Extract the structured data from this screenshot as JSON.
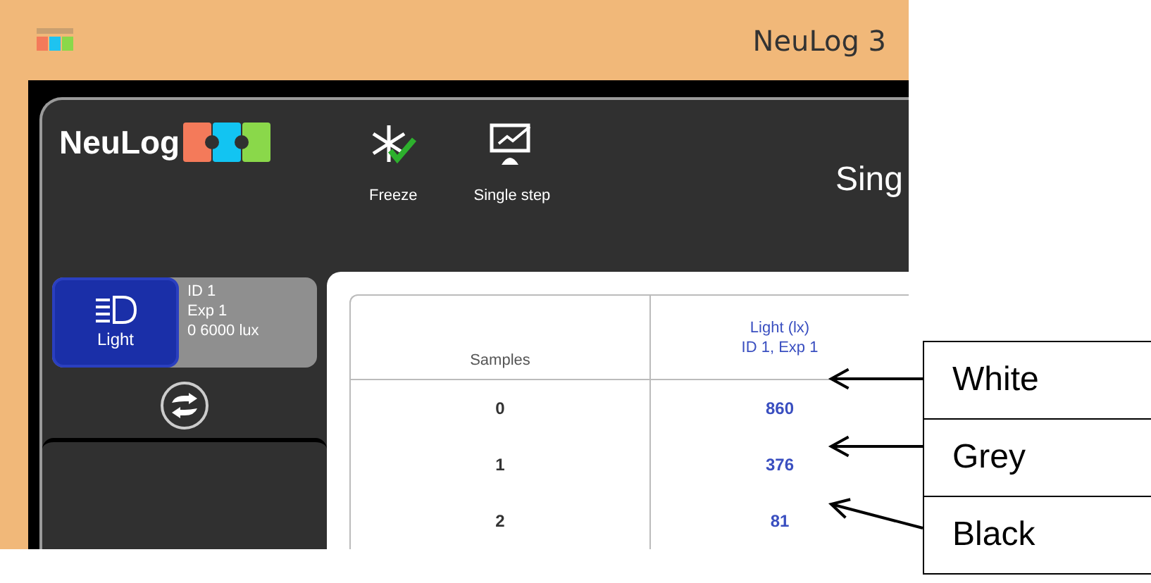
{
  "window": {
    "title": "NeuLog 3"
  },
  "toolbar": {
    "logo": "NeuLog",
    "buttons": [
      {
        "kind": "freeze",
        "label": "Freeze"
      },
      {
        "kind": "step",
        "label": "Single step"
      }
    ],
    "mode_title": "Sing"
  },
  "sensor": {
    "name": "Light",
    "lines": [
      "ID 1",
      "Exp 1",
      "0 6000 lux"
    ]
  },
  "table": {
    "columns": [
      {
        "lines": [
          "Samples"
        ]
      },
      {
        "lines": [
          "Light (lx)",
          "ID 1, Exp 1"
        ]
      }
    ],
    "rows": [
      [
        "0",
        "860"
      ],
      [
        "1",
        "376"
      ],
      [
        "2",
        "81"
      ]
    ]
  },
  "annotations": [
    {
      "label": "White"
    },
    {
      "label": "Grey"
    },
    {
      "label": "Black"
    }
  ]
}
